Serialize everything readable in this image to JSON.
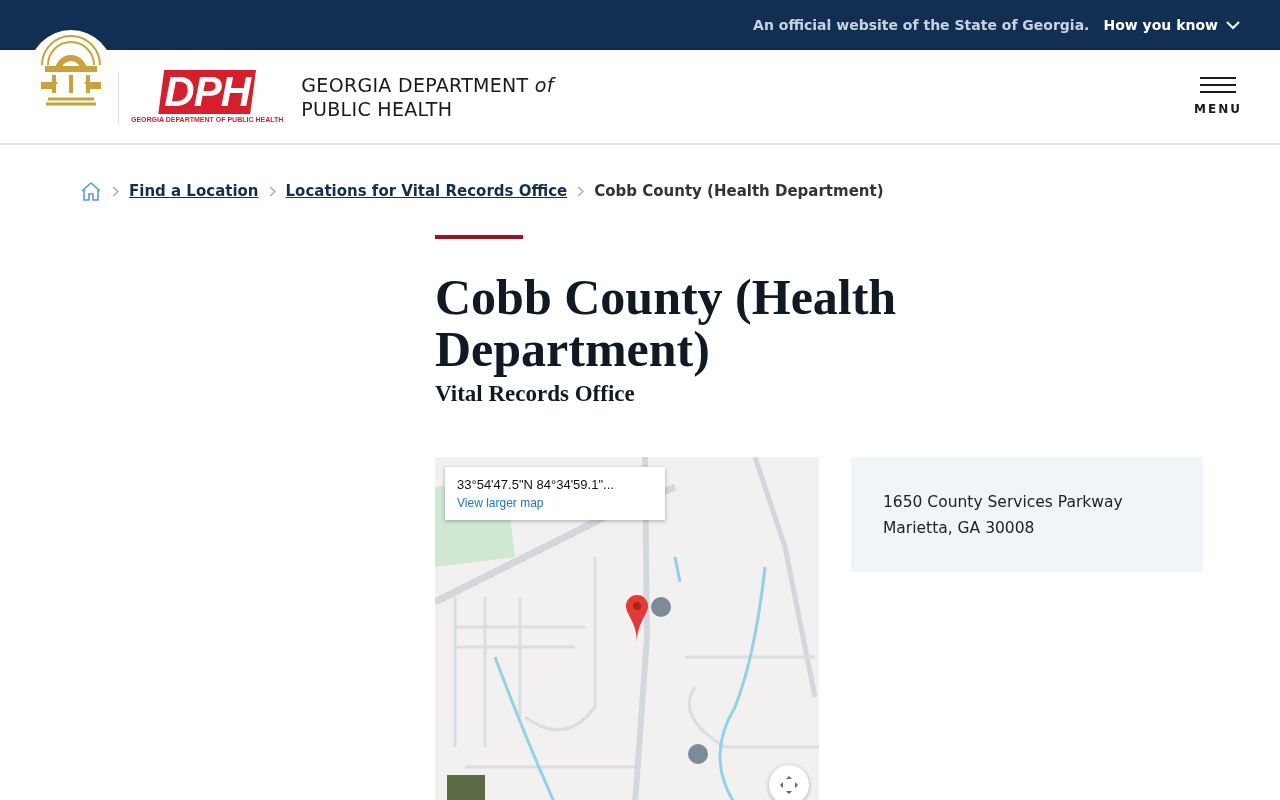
{
  "banner": {
    "text": "An official website of the State of Georgia.",
    "toggle": "How you know",
    "expanded": false
  },
  "header": {
    "logo_letters": "DPH",
    "logo_caption": "GEORGIA DEPARTMENT OF PUBLIC HEALTH",
    "title_lines": [
      "GEORGIA DEPARTMENT *of*",
      "PUBLIC HEALTH"
    ],
    "menu_label": "MENU"
  },
  "breadcrumb": [
    {
      "kind": "home"
    },
    {
      "kind": "link",
      "label": "Find a Location"
    },
    {
      "kind": "link",
      "label": "Locations for Vital Records Office"
    },
    {
      "kind": "current",
      "label": "Cobb County (Health Department)"
    }
  ],
  "page": {
    "title": "Cobb County (Health Department)",
    "subtitle": "Vital Records Office"
  },
  "map": {
    "coordinates": "33°54'47.5\"N 84°34'59.1\"...",
    "link": "View larger map"
  },
  "address": {
    "lines": [
      "1650 County Services Parkway",
      "Marietta, GA 30008"
    ]
  }
}
